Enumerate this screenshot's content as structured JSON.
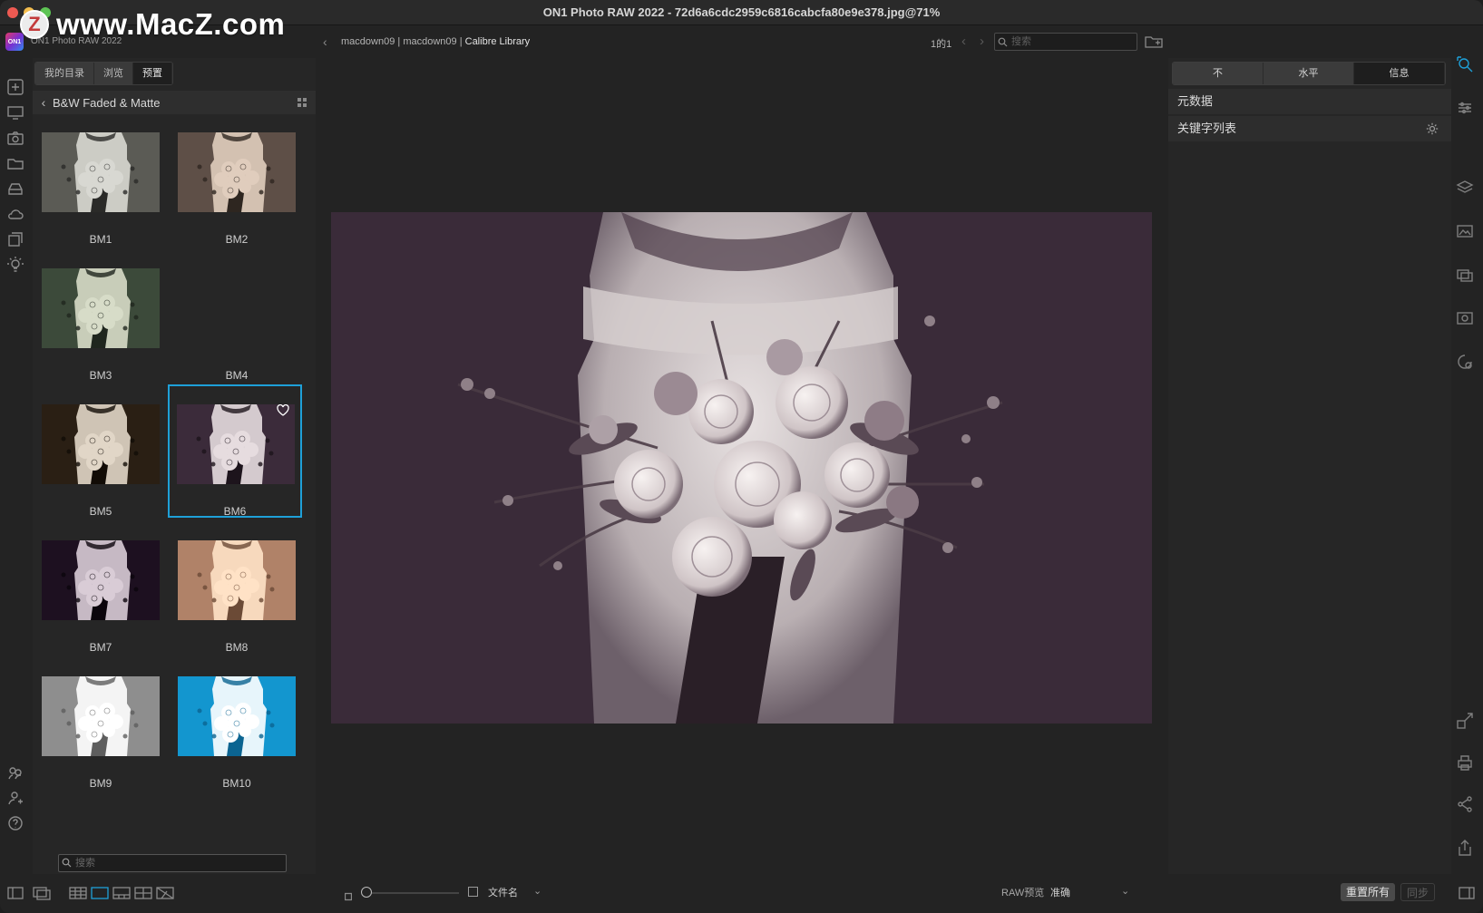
{
  "window": {
    "title": "ON1 Photo RAW 2022 - 72d6a6cdc2959c6816cabcfa80e9e378.jpg@71%",
    "app_name": "ON1 Photo RAW 2022",
    "app_logo_text": "ON1"
  },
  "watermark": {
    "logo": "Z",
    "text": "www.MacZ.com"
  },
  "left_tabs": [
    "我的目录",
    "浏览",
    "预置"
  ],
  "preset_group": {
    "title": "B&W Faded & Matte"
  },
  "presets": [
    {
      "label": "BM1",
      "bg": "#5b5b55",
      "fg": "#d8d8d2",
      "dark": "#2a2a28"
    },
    {
      "label": "BM2",
      "bg": "#5e4f47",
      "fg": "#e0cdbd",
      "dark": "#2e2620"
    },
    {
      "label": "BM3",
      "bg": "#3c4a3a",
      "fg": "#d7dcc8",
      "dark": "#1f261e"
    },
    {
      "label": "BM4",
      "bg": "",
      "fg": "",
      "dark": ""
    },
    {
      "label": "BM5",
      "bg": "#2a1f14",
      "fg": "#e1d6c7",
      "dark": "#120c06"
    },
    {
      "label": "BM6",
      "bg": "#3b2b3a",
      "fg": "#e6dcdf",
      "dark": "#1d141c"
    },
    {
      "label": "BM7",
      "bg": "#1d1020",
      "fg": "#d9ccd6",
      "dark": "#0b050c"
    },
    {
      "label": "BM8",
      "bg": "#b08268",
      "fg": "#ffe2c6",
      "dark": "#6b4a36"
    },
    {
      "label": "BM9",
      "bg": "#8e8e8e",
      "fg": "#ffffff",
      "dark": "#5e5e5e"
    },
    {
      "label": "BM10",
      "bg": "#1396cf",
      "fg": "#ffffff",
      "dark": "#0b6491"
    }
  ],
  "left_search": {
    "placeholder": "搜索"
  },
  "breadcrumb": {
    "parts": [
      "macdown09",
      "macdown09"
    ],
    "current": "Calibre Library",
    "sep": "|"
  },
  "pagination": {
    "text": "1的1"
  },
  "top_search": {
    "placeholder": "搜索"
  },
  "right_tabs": [
    "不",
    "水平",
    "信息"
  ],
  "right_rows": {
    "metadata": "元数据",
    "keywords": "关键字列表"
  },
  "bottom": {
    "filename_label": "文件名",
    "raw_preview_label": "RAW预览",
    "raw_preview_value": "准确",
    "reset_all": "重置所有",
    "sync": "同步"
  },
  "colors": {
    "accent": "#1ea0d8",
    "preview_bg": "#3a2b39",
    "panel_bg": "#262626"
  }
}
